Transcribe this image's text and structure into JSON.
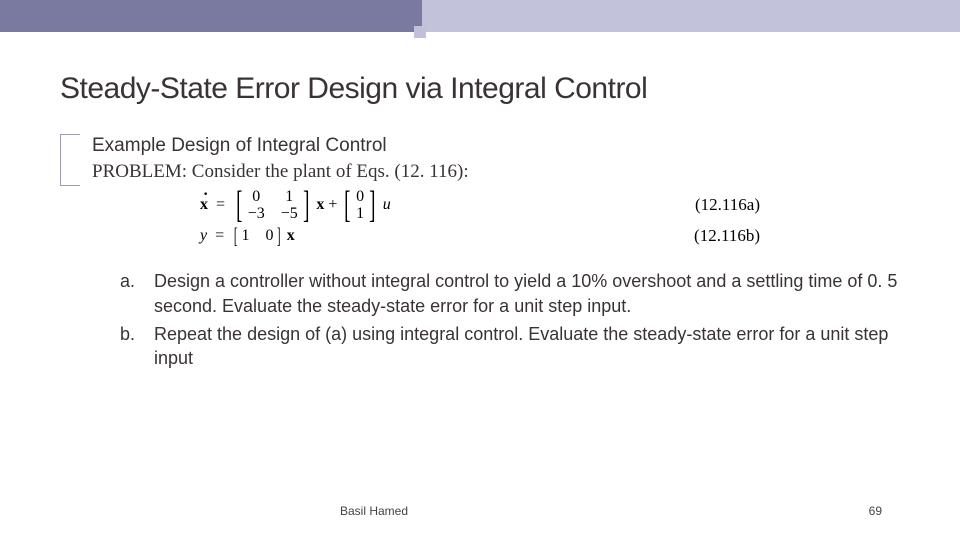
{
  "title": "Steady-State Error Design via Integral Control",
  "subhead1": "Example Design of Integral Control",
  "subhead2": "PROBLEM: Consider the plant of Eqs. (12. 116):",
  "eq": {
    "m2x2": {
      "a": "0",
      "b": "1",
      "c": "−3",
      "d": "−5"
    },
    "b2x1": {
      "a": "0",
      "b": "1"
    },
    "c1x2": {
      "a": "1",
      "b": "0"
    },
    "u": "u",
    "label_a": "(12.116a)",
    "label_b": "(12.116b)"
  },
  "items": {
    "a": "Design a controller without integral control to yield a 10% overshoot and a settling time of 0. 5 second. Evaluate the steady-state error for a unit step input.",
    "b": "Repeat the design of (a) using integral control. Evaluate the steady-state error for a unit step input"
  },
  "markers": {
    "a": "a.",
    "b": "b."
  },
  "footer": {
    "author": "Basil Hamed",
    "page": "69"
  }
}
